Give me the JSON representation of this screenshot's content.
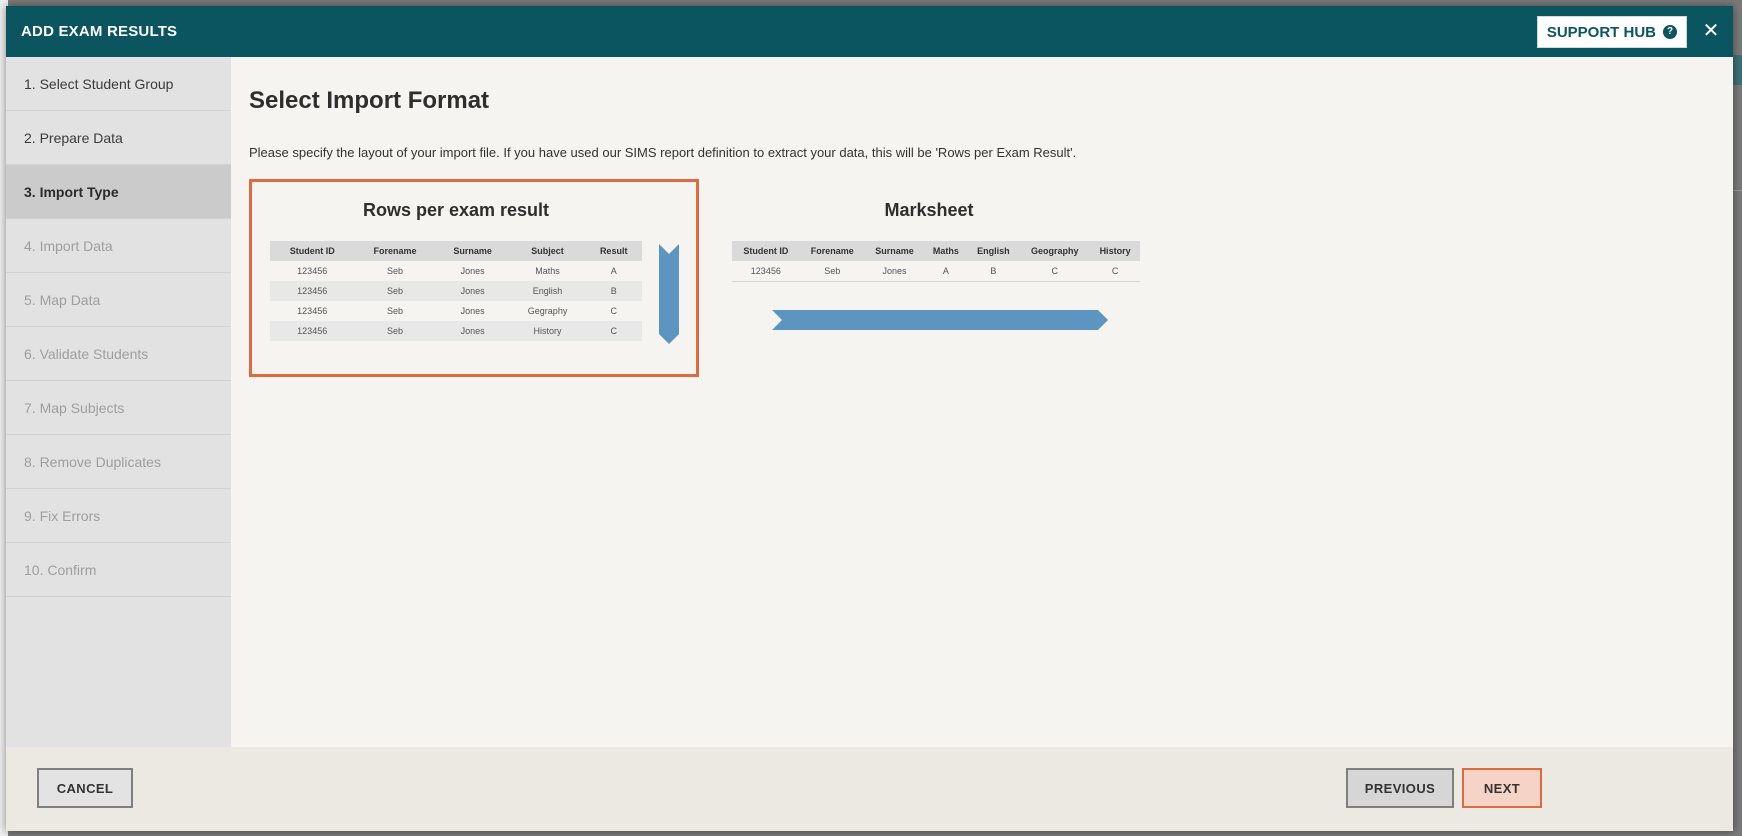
{
  "header": {
    "title": "ADD EXAM RESULTS",
    "support_label": "SUPPORT HUB",
    "support_icon": "question-circle-icon",
    "close_symbol": "✕",
    "bg_color": "#0b5560"
  },
  "steps": [
    {
      "label": "1. Select Student Group",
      "state": "done"
    },
    {
      "label": "2. Prepare Data",
      "state": "done"
    },
    {
      "label": "3. Import Type",
      "state": "active"
    },
    {
      "label": "4. Import Data",
      "state": "pending"
    },
    {
      "label": "5. Map Data",
      "state": "pending"
    },
    {
      "label": "6. Validate Students",
      "state": "pending"
    },
    {
      "label": "7. Map Subjects",
      "state": "pending"
    },
    {
      "label": "8. Remove Duplicates",
      "state": "pending"
    },
    {
      "label": "9. Fix Errors",
      "state": "pending"
    },
    {
      "label": "10. Confirm",
      "state": "pending"
    }
  ],
  "main": {
    "title": "Select Import Format",
    "description": "Please specify the layout of your import file. If you have used our SIMS report definition to extract your data, this will be 'Rows per Exam Result'.",
    "selected_format": "rows",
    "selected_border_color": "#e06a3f",
    "arrow_color": "#5b95c0",
    "formats": {
      "rows": {
        "title": "Rows per exam result",
        "columns": [
          "Student ID",
          "Forename",
          "Surname",
          "Subject",
          "Result"
        ],
        "rows": [
          [
            "123456",
            "Seb",
            "Jones",
            "Maths",
            "A"
          ],
          [
            "123456",
            "Seb",
            "Jones",
            "English",
            "B"
          ],
          [
            "123456",
            "Seb",
            "Jones",
            "Gegraphy",
            "C"
          ],
          [
            "123456",
            "Seb",
            "Jones",
            "History",
            "C"
          ]
        ]
      },
      "marksheet": {
        "title": "Marksheet",
        "columns": [
          "Student ID",
          "Forename",
          "Surname",
          "Maths",
          "English",
          "Geography",
          "History"
        ],
        "rows": [
          [
            "123456",
            "Seb",
            "Jones",
            "A",
            "B",
            "C",
            "C"
          ]
        ]
      }
    }
  },
  "footer": {
    "cancel_label": "CANCEL",
    "previous_label": "PREVIOUS",
    "next_label": "NEXT"
  }
}
